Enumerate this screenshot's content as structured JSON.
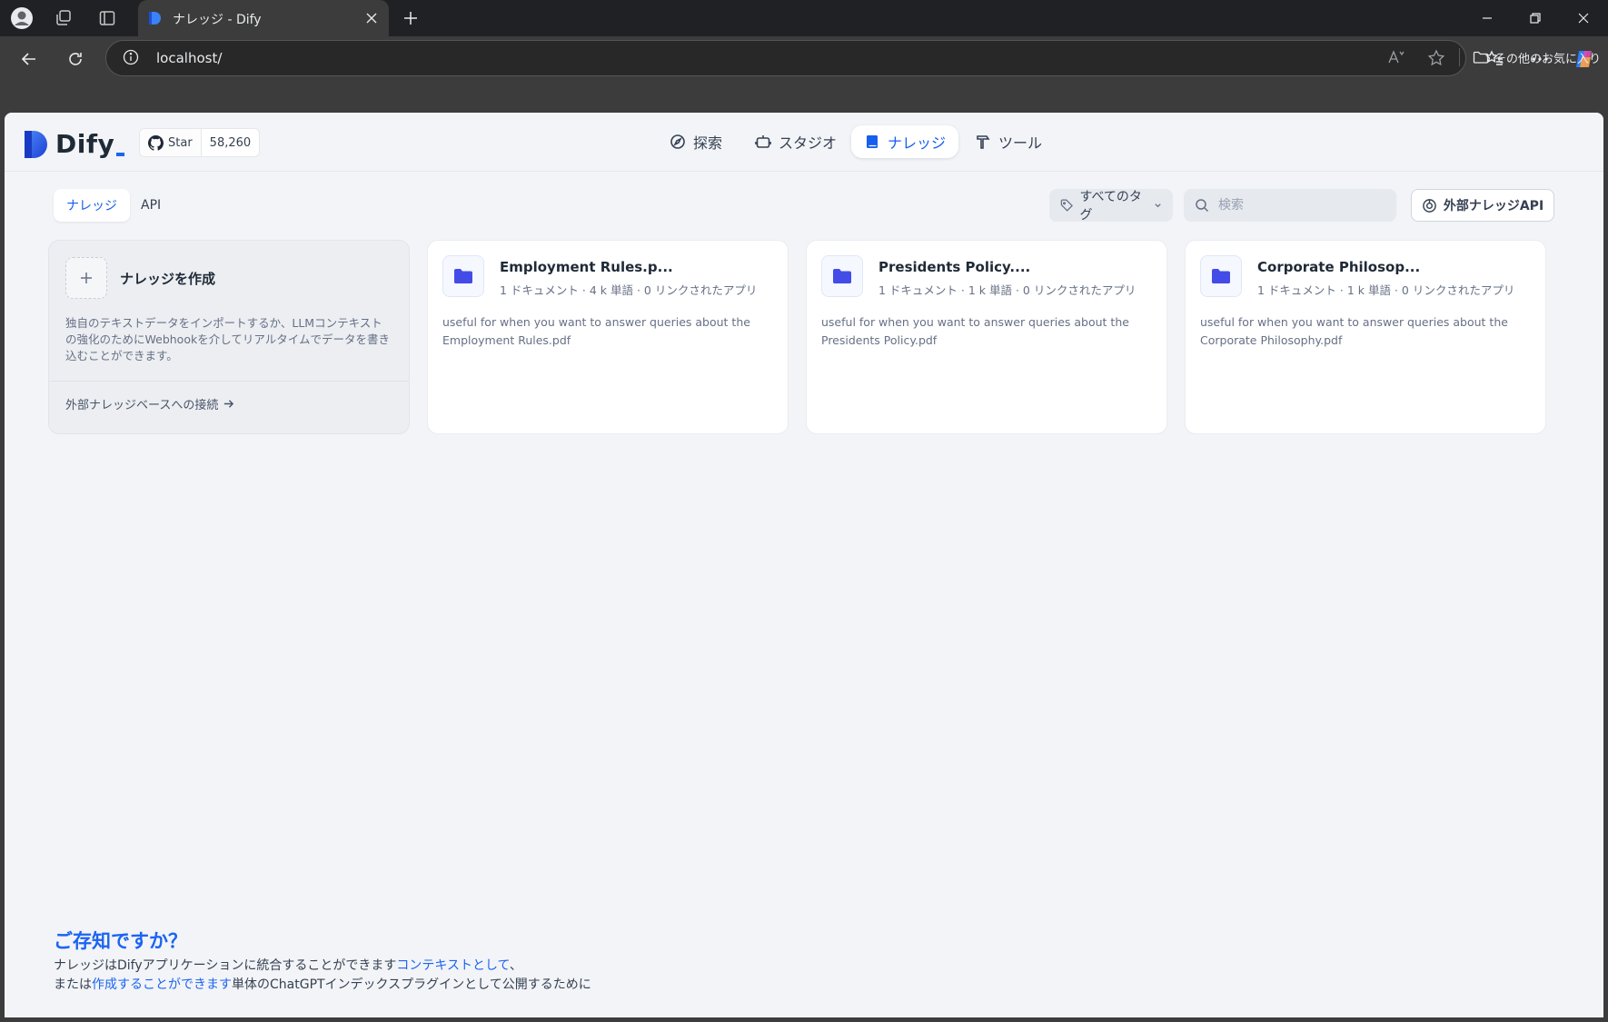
{
  "browser": {
    "tab_title": "ナレッジ - Dify",
    "url": "localhost/",
    "bookmark_folder": "その他のお気に入り"
  },
  "header": {
    "logo_text": "Dify",
    "github_star_label": "Star",
    "github_star_count": "58,260",
    "nav": [
      {
        "label": "探索",
        "icon": "compass-icon",
        "active": false
      },
      {
        "label": "スタジオ",
        "icon": "robot-icon",
        "active": false
      },
      {
        "label": "ナレッジ",
        "icon": "book-icon",
        "active": true
      },
      {
        "label": "ツール",
        "icon": "hammer-icon",
        "active": false
      }
    ]
  },
  "toolbar": {
    "tabs": [
      {
        "label": "ナレッジ",
        "active": true
      },
      {
        "label": "API",
        "active": false
      }
    ],
    "tag_filter_label": "すべてのタグ",
    "search_placeholder": "検索",
    "external_api_label": "外部ナレッジAPI"
  },
  "create_card": {
    "title": "ナレッジを作成",
    "description": "独自のテキストデータをインポートするか、LLMコンテキストの強化のためにWebhookを介してリアルタイムでデータを書き込むことができます。",
    "link_label": "外部ナレッジベースへの接続"
  },
  "datasets": [
    {
      "name": "Employment Rules.p...",
      "meta": "1 ドキュメント · 4 k 単語 · 0 リンクされたアプリ",
      "description": "useful for when you want to answer queries about the Employment Rules.pdf"
    },
    {
      "name": "Presidents Policy....",
      "meta": "1 ドキュメント · 1 k 単語 · 0 リンクされたアプリ",
      "description": "useful for when you want to answer queries about the Presidents Policy.pdf"
    },
    {
      "name": "Corporate Philosop...",
      "meta": "1 ドキュメント · 1 k 単語 · 0 リンクされたアプリ",
      "description": "useful for when you want to answer queries about the Corporate Philosophy.pdf"
    }
  ],
  "footer": {
    "title": "ご存知ですか？",
    "line1_text": "ナレッジはDifyアプリケーションに統合することができます",
    "line1_link": "コンテキストとして",
    "line1_end": "、",
    "line2_prefix": "または",
    "line2_link": "作成することができます",
    "line2_suffix": "単体のChatGPTインデックスプラグインとして公開するために"
  },
  "colors": {
    "accent": "#155eef",
    "folder_icon": "#444ce7",
    "app_bg": "#f2f4f7"
  }
}
